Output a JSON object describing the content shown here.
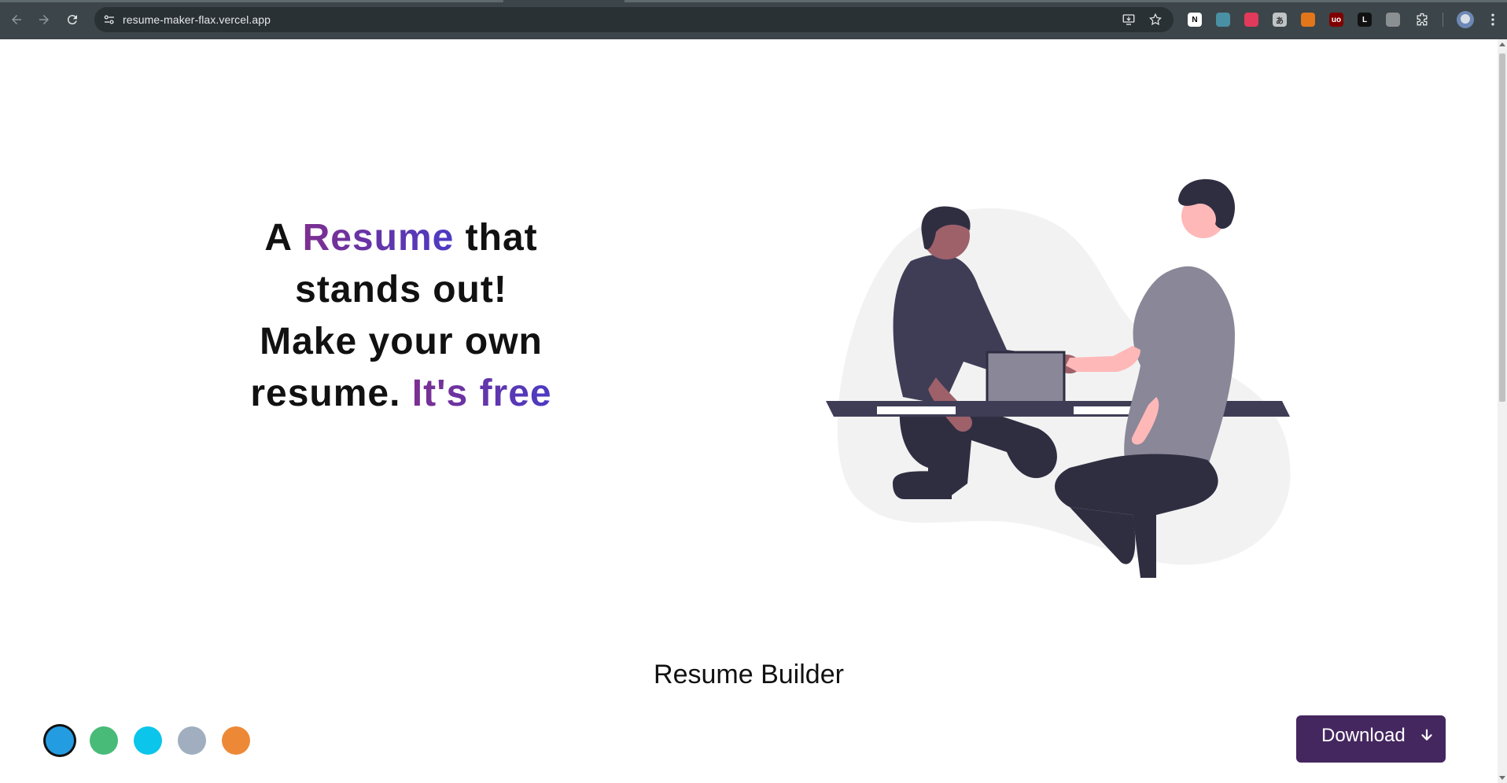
{
  "browser": {
    "url": "resume-maker-flax.vercel.app",
    "extensions": [
      {
        "name": "notion-icon",
        "label": "N",
        "color": "#ffffff",
        "text": "#000000"
      },
      {
        "name": "clock-extension-icon",
        "label": "",
        "color": "#4a90a4",
        "text": "#ffffff"
      },
      {
        "name": "raspberry-extension-icon",
        "label": "",
        "color": "#e23a5a",
        "text": "#ffffff"
      },
      {
        "name": "kana-extension-icon",
        "label": "あ",
        "color": "#bfc4c6",
        "text": "#333333"
      },
      {
        "name": "metamask-icon",
        "label": "",
        "color": "#e2761b",
        "text": "#ffffff"
      },
      {
        "name": "ublock-origin-icon",
        "label": "uo",
        "color": "#800000",
        "text": "#ffffff"
      },
      {
        "name": "lighthouse-extension-icon",
        "label": "L",
        "color": "#111111",
        "text": "#ffffff"
      },
      {
        "name": "pin-extension-icon",
        "label": "",
        "color": "#8a8f91",
        "text": "#ffffff"
      }
    ]
  },
  "hero": {
    "line1_a": "A ",
    "line1_highlight": "Resume",
    "line1_b": " that",
    "line2": "stands out!",
    "line3": "Make your own",
    "line4_a": "resume. ",
    "line4_highlight": "It's free",
    "highlight_colors": [
      "#7d2f8f",
      "#4b3bc4"
    ]
  },
  "builder": {
    "title": "Resume Builder",
    "theme_colors": [
      "#239ce2",
      "#48bb78",
      "#0bc5ea",
      "#a0aec0",
      "#ed8936"
    ],
    "selected_color_index": 0,
    "download_label": "Download"
  }
}
